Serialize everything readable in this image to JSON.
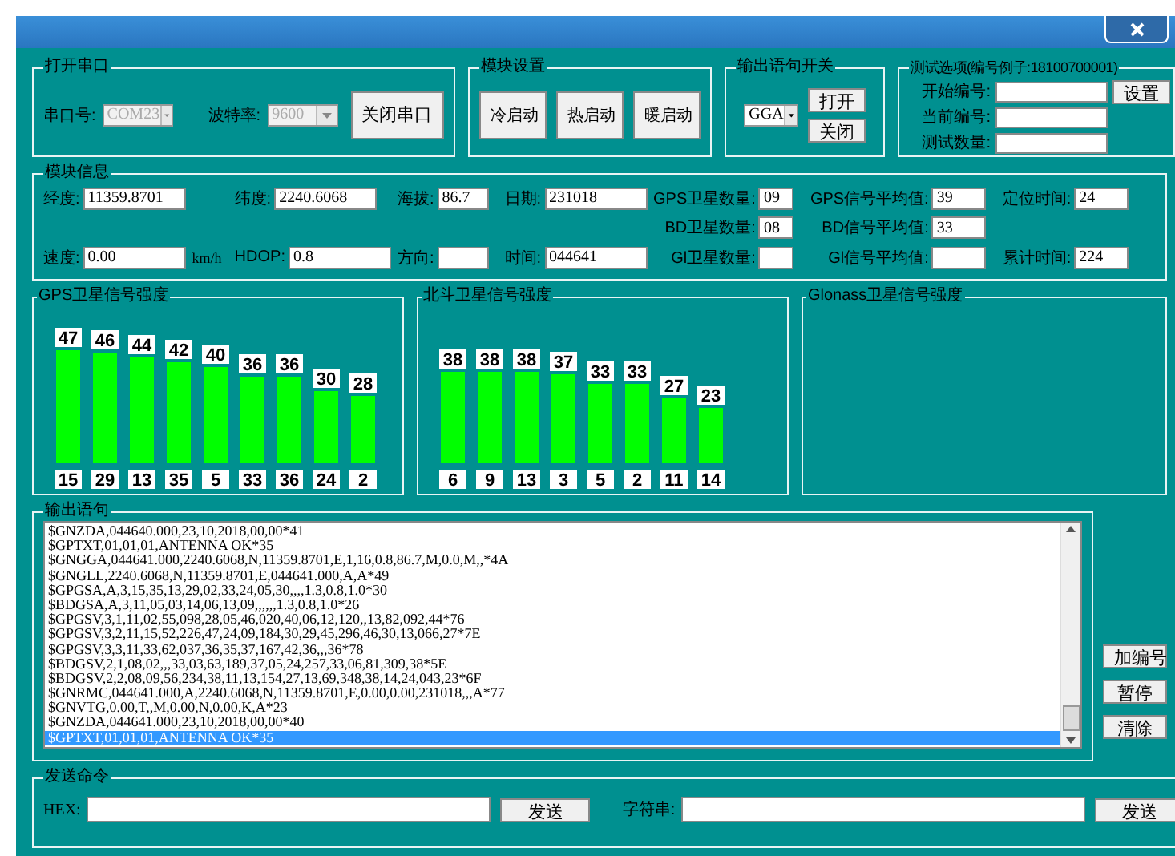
{
  "serial_port": {
    "title": "打开串口",
    "port_label": "串口号:",
    "port": "COM23",
    "baud_label": "波特率:",
    "baud": "9600",
    "disabled": true,
    "button": "关闭串口"
  },
  "module_settings": {
    "title": "模块设置",
    "buttons": [
      "冷启动",
      "热启动",
      "暖启动"
    ]
  },
  "output_switch": {
    "title": "输出语句开关",
    "sentence": "GGA",
    "buttons": [
      "打开",
      "关闭"
    ]
  },
  "test_options": {
    "title": "测试选项(编号例子:18100700001)",
    "fields": [
      {
        "label": "开始编号:"
      },
      {
        "label": "当前编号:"
      },
      {
        "label": "测试数量:"
      }
    ],
    "button": "设置"
  },
  "module_info": {
    "title": "模块信息",
    "columns": [
      {
        "fields": [
          {
            "label": "经度:",
            "value": "11359.8701"
          },
          {
            "label": "速度:",
            "value": "0.00",
            "unit": "km/h"
          }
        ]
      },
      {
        "fields": [
          {
            "label": "纬度:",
            "value": "2240.6068"
          },
          {
            "label": "HDOP:",
            "value": "0.8"
          }
        ]
      },
      {
        "fields": [
          {
            "label": "海拔:",
            "value": "86.7"
          },
          {
            "label": "方向:"
          }
        ]
      },
      {
        "fields": [
          {
            "label": "日期:",
            "value": "231018"
          },
          {
            "label": "时间:",
            "value": "044641"
          }
        ]
      },
      {
        "fields": [
          {
            "label": "GPS卫星数量:",
            "value": "09"
          },
          {
            "label": "BD卫星数量:",
            "value": "08"
          },
          {
            "label": "Gl卫星数量:"
          }
        ]
      },
      {
        "fields": [
          {
            "label": "GPS信号平均值:",
            "value": "39"
          },
          {
            "label": "BD信号平均值:",
            "value": "33"
          },
          {
            "label": "Gl信号平均值:"
          }
        ]
      },
      {
        "fields": [
          {
            "label": "定位时间:",
            "value": "24"
          },
          {
            "label": "累计时间:",
            "value": "224"
          }
        ]
      }
    ]
  },
  "signal_panels": [
    {
      "title": "GPS卫星信号强度",
      "chart_data": {
        "type": "bar",
        "categories": [
          "15",
          "29",
          "13",
          "35",
          "5",
          "33",
          "36",
          "24",
          "2"
        ],
        "values": [
          47,
          46,
          44,
          42,
          40,
          36,
          36,
          30,
          28
        ],
        "data_labels": true
      }
    },
    {
      "title": "北斗卫星信号强度",
      "chart_data": {
        "type": "bar",
        "categories": [
          "6",
          "9",
          "13",
          "3",
          "5",
          "2",
          "11",
          "14"
        ],
        "values": [
          38,
          38,
          38,
          37,
          33,
          33,
          27,
          23
        ],
        "data_labels": true
      }
    },
    {
      "title": "Glonass卫星信号强度"
    }
  ],
  "output": {
    "title": "输出语句",
    "lines": [
      {
        "text": "$GNZDA,044640.000,23,10,2018,00,00*41",
        "selected": false
      },
      {
        "text": "$GPTXT,01,01,01,ANTENNA OK*35",
        "selected": false
      },
      {
        "text": "$GNGGA,044641.000,2240.6068,N,11359.8701,E,1,16,0.8,86.7,M,0.0,M,,*4A",
        "selected": false
      },
      {
        "text": "$GNGLL,2240.6068,N,11359.8701,E,044641.000,A,A*49",
        "selected": false
      },
      {
        "text": "$GPGSA,A,3,15,35,13,29,02,33,24,05,30,,,,1.3,0.8,1.0*30",
        "selected": false
      },
      {
        "text": "$BDGSA,A,3,11,05,03,14,06,13,09,,,,,,1.3,0.8,1.0*26",
        "selected": false
      },
      {
        "text": "$GPGSV,3,1,11,02,55,098,28,05,46,020,40,06,12,120,,13,82,092,44*76",
        "selected": false
      },
      {
        "text": "$GPGSV,3,2,11,15,52,226,47,24,09,184,30,29,45,296,46,30,13,066,27*7E",
        "selected": false
      },
      {
        "text": "$GPGSV,3,3,11,33,62,037,36,35,37,167,42,36,,,36*78",
        "selected": false
      },
      {
        "text": "$BDGSV,2,1,08,02,,,33,03,63,189,37,05,24,257,33,06,81,309,38*5E",
        "selected": false
      },
      {
        "text": "$BDGSV,2,2,08,09,56,234,38,11,13,154,27,13,69,348,38,14,24,043,23*6F",
        "selected": false
      },
      {
        "text": "$GNRMC,044641.000,A,2240.6068,N,11359.8701,E,0.00,0.00,231018,,,A*77",
        "selected": false
      },
      {
        "text": "$GNVTG,0.00,T,,M,0.00,N,0.00,K,A*23",
        "selected": false
      },
      {
        "text": "$GNZDA,044641.000,23,10,2018,00,00*40",
        "selected": false
      },
      {
        "text": "$GPTXT,01,01,01,ANTENNA OK*35",
        "selected": true
      }
    ],
    "buttons": [
      "加编号",
      "暂停",
      "清除"
    ]
  },
  "send_command": {
    "title": "发送命令",
    "hex_label": "HEX:",
    "hex_button": "发送",
    "string_label": "字符串:",
    "string_button": "发送"
  }
}
